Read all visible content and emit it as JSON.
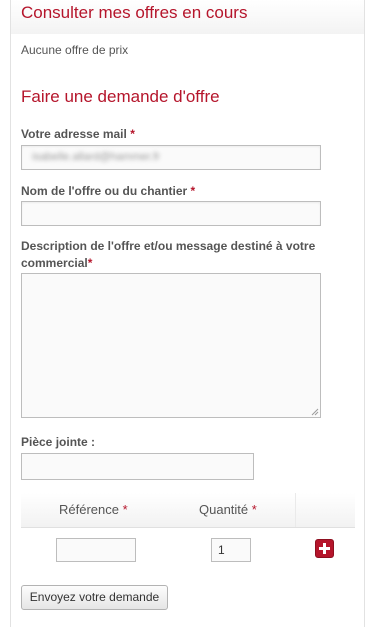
{
  "consult": {
    "heading": "Consulter mes offres en cours",
    "empty_text": "Aucune offre de prix"
  },
  "request": {
    "heading": "Faire une demande d'offre",
    "email_label": "Votre adresse mail",
    "email_value": "isabelle.allard@hammer.fr",
    "name_label": "Nom de l'offre ou du chantier",
    "name_value": "",
    "description_label_line1": "Description de l'offre et/ou message destiné à votre",
    "description_label_line2": "commercial",
    "attachment_label": "Pièce jointe :",
    "required_mark": "*",
    "table": {
      "reference_header": "Référence",
      "quantity_header": "Quantité",
      "reference_value": "",
      "quantity_value": "1"
    },
    "submit_label": "Envoyez votre demande"
  },
  "colors": {
    "accent": "#b5152b",
    "border": "#bdbdbd"
  },
  "icons": {
    "add": "plus-icon",
    "resize": "resize-grip-icon"
  }
}
